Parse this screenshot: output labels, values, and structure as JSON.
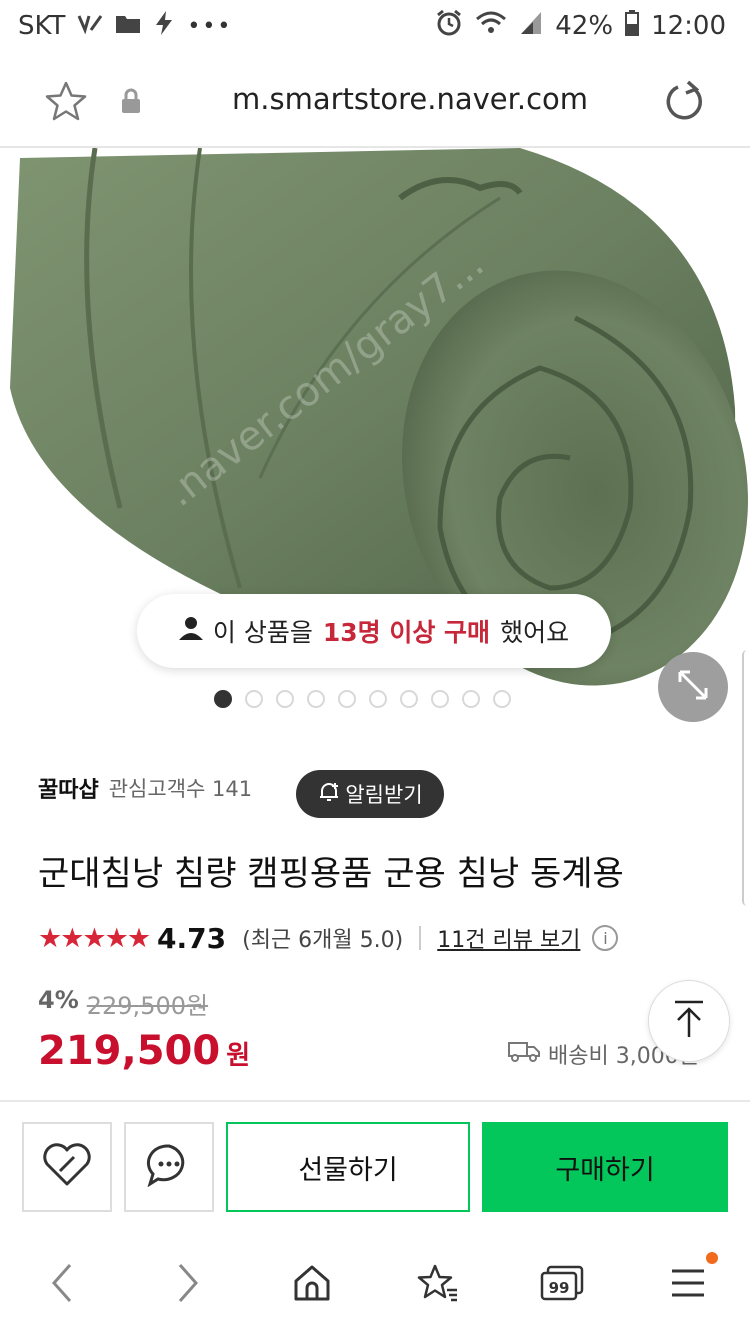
{
  "status_bar": {
    "carrier": "SKT",
    "battery": "42%",
    "time": "12:00"
  },
  "browser": {
    "url": "m.smartstore.naver.com"
  },
  "hero": {
    "purchase_notice": {
      "prefix": "이 상품을",
      "highlight": "13명 이상 구매",
      "suffix": "했어요"
    },
    "carousel_pages": 10,
    "carousel_active_index": 0
  },
  "store": {
    "name": "꿀따샵",
    "subscribers": "관심고객수 141",
    "notify_label": "알림받기"
  },
  "product": {
    "title": "군대침낭 침량 캠핑용품 군용 침낭 동계용",
    "stars": "★★★★★",
    "rating": "4.73",
    "recent_rating": "(최근 6개월 5.0)",
    "reviews_link": "11건 리뷰 보기",
    "info_label": "i",
    "discount": "4%",
    "original_price": "229,500원",
    "price": "219,500",
    "currency": "원",
    "shipping": "배송비 3,000원"
  },
  "actions": {
    "gift_label": "선물하기",
    "buy_label": "구매하기"
  },
  "colors": {
    "accent_green": "#03c75a",
    "price_red": "#c8102e",
    "highlight_red": "#c6283a"
  }
}
